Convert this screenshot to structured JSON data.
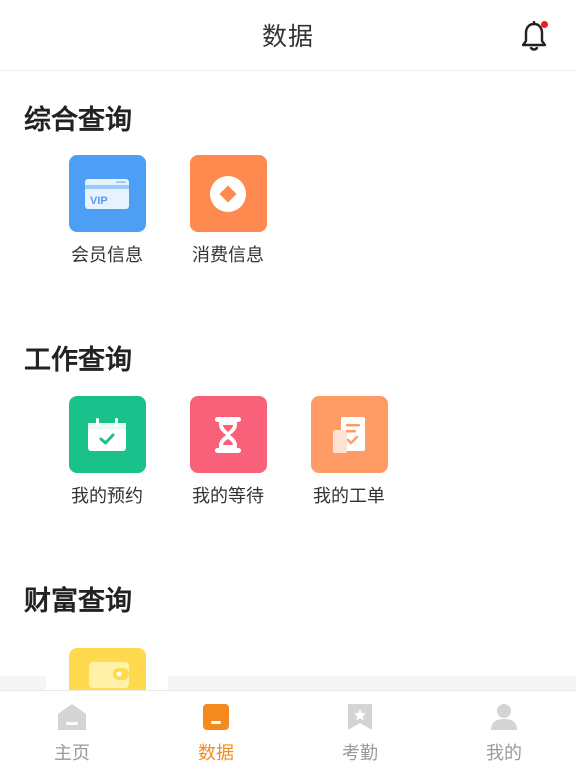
{
  "header": {
    "title": "数据",
    "bell_icon": "bell-icon",
    "has_notification": true
  },
  "sections": [
    {
      "title": "综合查询",
      "items": [
        {
          "label": "会员信息",
          "icon": "vip-card-icon",
          "color": "#4d9ff5"
        },
        {
          "label": "消费信息",
          "icon": "coin-icon",
          "color": "#ff8a50"
        }
      ]
    },
    {
      "title": "工作查询",
      "items": [
        {
          "label": "我的预约",
          "icon": "calendar-check-icon",
          "color": "#1bc18a"
        },
        {
          "label": "我的等待",
          "icon": "hourglass-icon",
          "color": "#f9607a"
        },
        {
          "label": "我的工单",
          "icon": "document-icon",
          "color": "#ff9b64"
        }
      ]
    },
    {
      "title": "财富查询",
      "items": [
        {
          "label": "",
          "icon": "wallet-icon",
          "color": "#ffd94e"
        }
      ]
    }
  ],
  "tabbar": {
    "active_color": "#f58b1e",
    "inactive_color": "#9a9a9a",
    "tabs": [
      {
        "label": "主页",
        "icon": "home-icon",
        "active": false
      },
      {
        "label": "数据",
        "icon": "data-icon",
        "active": true
      },
      {
        "label": "考勤",
        "icon": "attendance-bookmark-icon",
        "active": false
      },
      {
        "label": "我的",
        "icon": "user-icon",
        "active": false
      }
    ]
  }
}
